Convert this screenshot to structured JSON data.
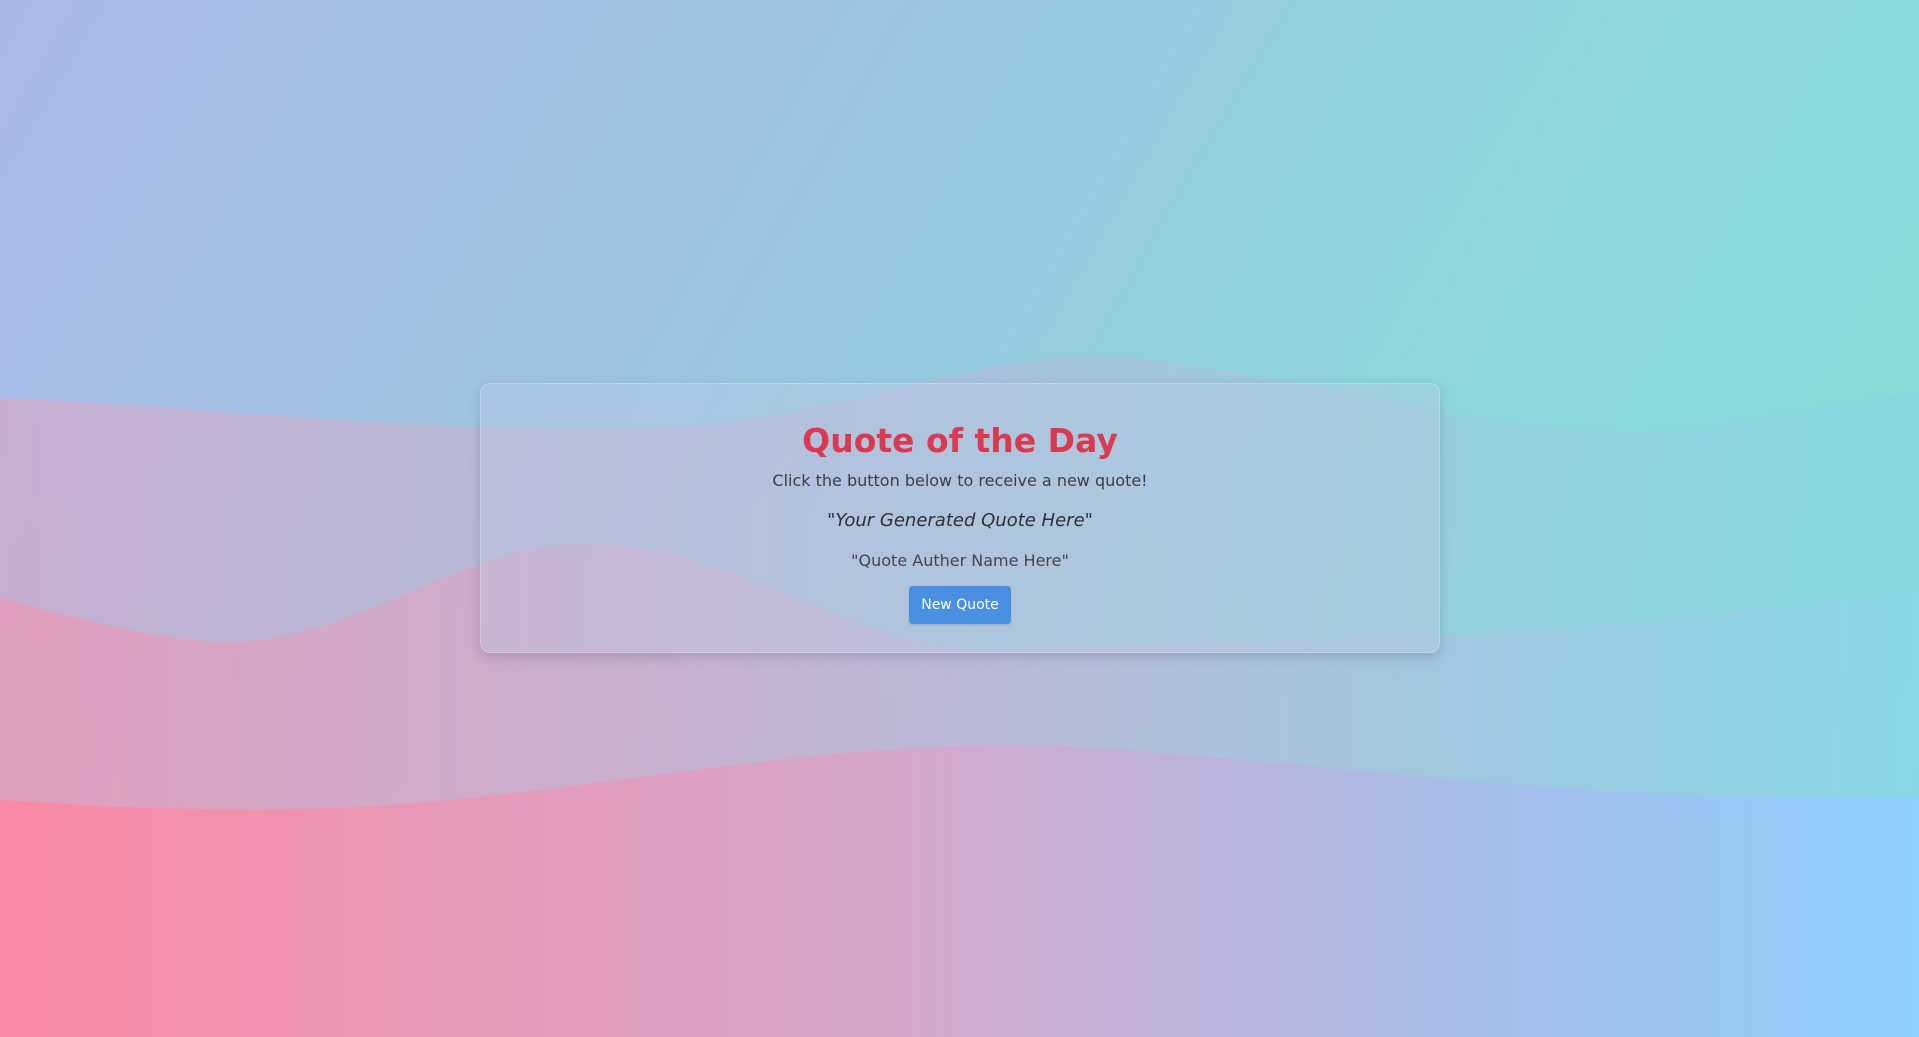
{
  "page": {
    "title": "Quote of the Day",
    "subtitle": "Click the button below to receive a new quote!",
    "quote_text": "\"Your Generated Quote Here\"",
    "author_text": "\"Quote Auther Name Here\"",
    "new_quote_button": "New Quote"
  },
  "colors": {
    "title": "#d93a4f",
    "button": "#4a90e2",
    "button_text": "#ffffff"
  }
}
